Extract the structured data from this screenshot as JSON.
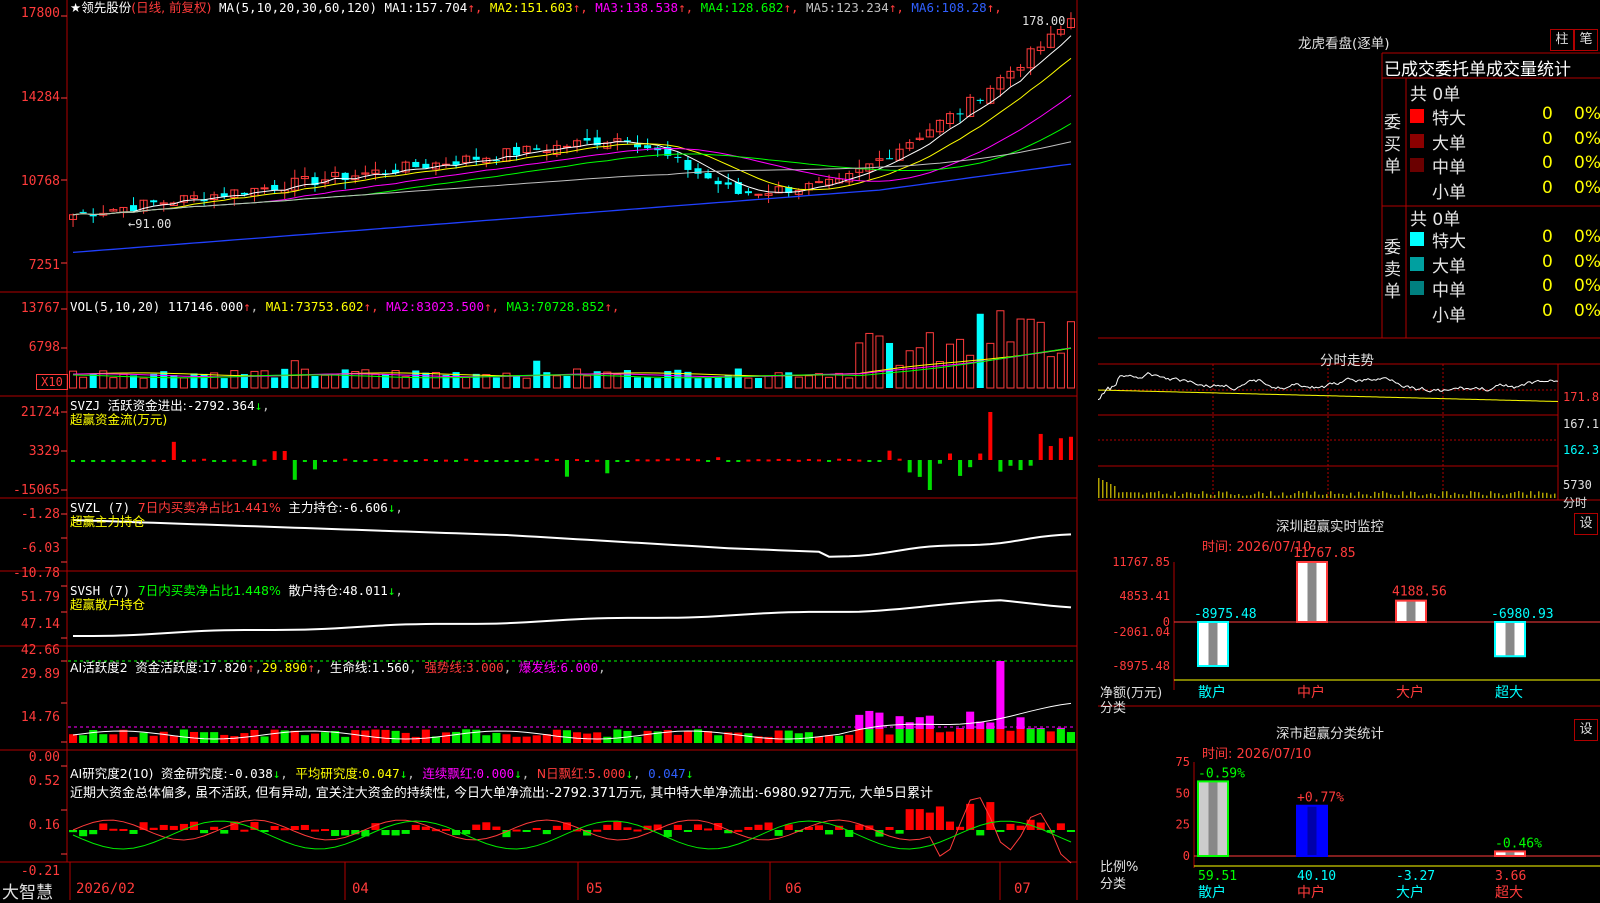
{
  "app_logo": "大智慧",
  "main": {
    "stock_label": "★领先股份",
    "period_label": "(日线, 前复权)",
    "ma_header": "MA(5,10,20,30,60,120)",
    "ma_values": [
      {
        "name": "MA1:",
        "value": "157.704",
        "color": "#ffffff"
      },
      {
        "name": "MA2:",
        "value": "151.603",
        "color": "#ffff00"
      },
      {
        "name": "MA3:",
        "value": "138.538",
        "color": "#ff00ff"
      },
      {
        "name": "MA4:",
        "value": "128.682",
        "color": "#00ff00"
      },
      {
        "name": "MA5:",
        "value": "123.234",
        "color": "#c0c0c0"
      },
      {
        "name": "MA6:",
        "value": "108.28",
        "color": "#3060ff"
      }
    ],
    "y_axis": [
      "17800",
      "14284",
      "10768",
      "7251"
    ],
    "high_label": "178.00",
    "low_label": "←91.00"
  },
  "volume": {
    "header": "VOL(5,10,20)",
    "value": "117146.000",
    "mas": [
      {
        "name": "MA1:",
        "value": "73753.602",
        "color": "#ffff00"
      },
      {
        "name": "MA2:",
        "value": "83023.500",
        "color": "#ff00ff"
      },
      {
        "name": "MA3:",
        "value": "70728.852",
        "color": "#00ff00"
      }
    ],
    "y_axis": [
      "13767",
      "6798"
    ],
    "unit": "X10"
  },
  "svzj": {
    "line1_a": "SVZJ",
    "line1_b": "活跃资金进出:",
    "line1_val": "-2792.364",
    "line2": "超赢资金流(万元)",
    "y_axis": [
      "21724",
      "3329",
      "-15065"
    ]
  },
  "svzl": {
    "a": "SVZL (7)",
    "b": "7日内买卖净占比1.441%",
    "c": "主力持仓:",
    "val": "-6.606",
    "line2": "超赢主力持仓",
    "y_axis": [
      "-1.28",
      "-6.03",
      "-10.78"
    ]
  },
  "svsh": {
    "a": "SVSH (7)",
    "b": "7日内买卖净占比1.448%",
    "c": "散户持仓:",
    "val": "48.011",
    "line2": "超赢散户持仓",
    "y_axis": [
      "51.79",
      "47.14",
      "42.66"
    ]
  },
  "ai_act": {
    "a": "AI活跃度2",
    "b": "资金活跃度:",
    "v1": "17.820",
    "v2": "29.890",
    "c": "生命线:",
    "v3": "1.560",
    "d": "强势线:",
    "v4": "3.000",
    "e": "爆发线:",
    "v5": "6.000",
    "y_axis": [
      "29.89",
      "14.76",
      "0.00"
    ]
  },
  "ai_res": {
    "a": "AI研究度2(10)",
    "b": "资金研究度:",
    "v1": "-0.038",
    "c": "平均研究度:",
    "v2": "0.047",
    "d": "连续飘红:",
    "v3": "0.000",
    "e": "N日飘红:",
    "v4": "5.000",
    "v5": "0.047",
    "text": "近期大资金总体偏多, 虽不活跃, 但有异动, 宜关注大资金的持续性, 今日大单净流出:-2792.371万元, 其中特大单净流出:-6980.927万元, 大单5日累计",
    "y_axis": [
      "0.52",
      "0.16",
      "-0.21"
    ]
  },
  "x_axis": [
    "2026/02",
    "04",
    "05",
    "06",
    "07"
  ],
  "side": {
    "title": "龙虎看盘(逐单)",
    "btn1": "柱",
    "btn2": "笔",
    "stats_header": "已成交委托单成交量统计",
    "buy": {
      "label": "委买单",
      "count": "共 0单",
      "rows": [
        {
          "name": "特大",
          "v": "0",
          "p": "0%",
          "color": "#ff0000"
        },
        {
          "name": "大单",
          "v": "0",
          "p": "0%",
          "color": "#8b0000"
        },
        {
          "name": "中单",
          "v": "0",
          "p": "0%",
          "color": "#6a0000"
        },
        {
          "name": "小单",
          "v": "0",
          "p": "0%",
          "color": "#000000"
        }
      ]
    },
    "sell": {
      "label": "委卖单",
      "count": "共 0单",
      "rows": [
        {
          "name": "特大",
          "v": "0",
          "p": "0%",
          "color": "#00ffff"
        },
        {
          "name": "大单",
          "v": "0",
          "p": "0%",
          "color": "#00a0a0"
        },
        {
          "name": "中单",
          "v": "0",
          "p": "0%",
          "color": "#008080"
        },
        {
          "name": "小单",
          "v": "0",
          "p": "0%",
          "color": "#000000"
        }
      ]
    },
    "intraday": {
      "title": "分时走势",
      "y_axis": [
        "171.8",
        "167.1",
        "162.3",
        "5730"
      ],
      "bottom_label": "分时"
    },
    "sz_monitor": {
      "title": "深圳超赢实时监控",
      "btn": "设",
      "time": "时间: 2026/07/10",
      "y_axis": [
        "11767.85",
        "4853.41",
        "0",
        "-2061.04",
        "-8975.48"
      ],
      "unit_label": "净额(万元)",
      "cat_label": "分类",
      "bars": [
        {
          "cat": "散户",
          "value": -8975.48,
          "label": "-8975.48"
        },
        {
          "cat": "中户",
          "value": 11767.85,
          "label": "11767.85"
        },
        {
          "cat": "大户",
          "value": 4188.56,
          "label": "4188.56"
        },
        {
          "cat": "超大",
          "value": -6980.93,
          "label": "-6980.93"
        }
      ]
    },
    "sz_class": {
      "title": "深市超赢分类统计",
      "btn": "设",
      "time": "时间: 2026/07/10",
      "y_axis": [
        "75",
        "50",
        "25",
        "0"
      ],
      "unit_label": "比例%",
      "cat_label": "分类",
      "bars": [
        {
          "cat": "散户",
          "value": 59.51,
          "label": "59.51",
          "change": "-0.59%"
        },
        {
          "cat": "中户",
          "value": 40.1,
          "label": "40.10",
          "change": "+0.77%"
        },
        {
          "cat": "大户",
          "value": -3.27,
          "label": "-3.27",
          "change": ""
        },
        {
          "cat": "超大",
          "value": 3.66,
          "label": "3.66",
          "change": "-0.46%"
        }
      ]
    }
  }
}
